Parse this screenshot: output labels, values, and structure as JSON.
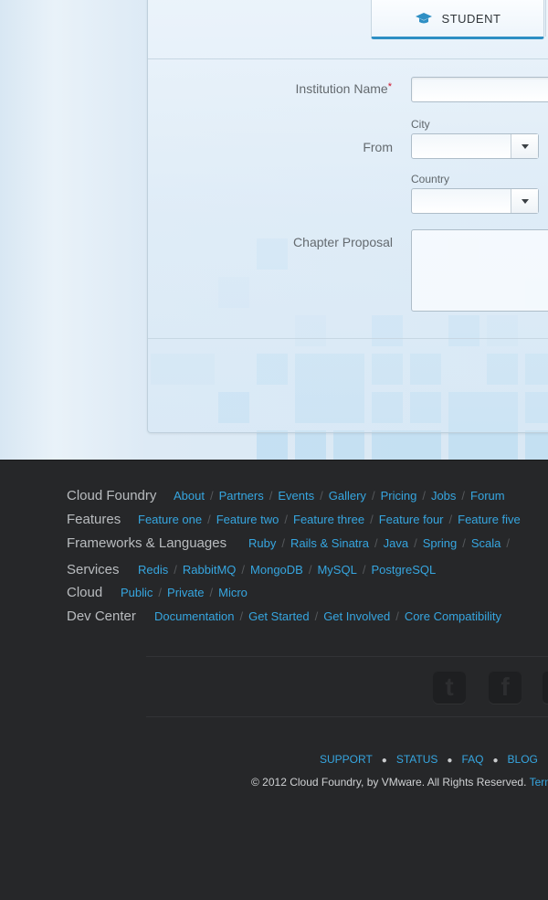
{
  "form": {
    "tab_label": "STUDENT",
    "institution_label": "Institution Name",
    "required_mark": "*",
    "from_label": "From",
    "city_label": "City",
    "country_label": "Country",
    "chapter_label": "Chapter Proposal"
  },
  "footer": {
    "rows": [
      {
        "category": "Cloud Foundry",
        "links": [
          "About",
          "Partners",
          "Events",
          "Gallery",
          "Pricing",
          "Jobs",
          "Forum"
        ]
      },
      {
        "category": "Features",
        "links": [
          "Feature one",
          "Feature two",
          "Feature three",
          "Feature four",
          "Feature five"
        ]
      },
      {
        "category": "Frameworks & Languages",
        "links": [
          "Ruby",
          "Rails & Sinatra",
          "Java",
          "Spring",
          "Scala"
        ]
      },
      {
        "category": "Services",
        "links": [
          "Redis",
          "RabbitMQ",
          "MongoDB",
          "MySQL",
          "PostgreSQL"
        ]
      },
      {
        "category": "Cloud",
        "links": [
          "Public",
          "Private",
          "Micro"
        ]
      },
      {
        "category": "Dev Center",
        "links": [
          "Documentation",
          "Get Started",
          "Get Involved",
          "Core Compatibility"
        ]
      }
    ],
    "social": [
      "twitter-icon",
      "facebook-icon"
    ],
    "bottom_links": [
      "SUPPORT",
      "STATUS",
      "FAQ",
      "BLOG"
    ],
    "copyright": "© 2012 Cloud Foundry, by VMware. All Rights Reserved.",
    "terms": "Terms"
  },
  "colors": {
    "accent": "#2e8fc4",
    "link": "#36a6e0",
    "footer_bg": "#262729"
  }
}
